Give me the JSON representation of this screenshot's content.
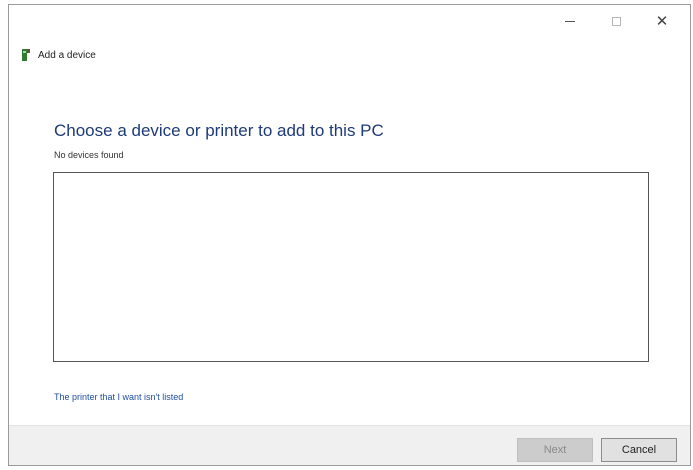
{
  "window": {
    "title": "Add a device",
    "controls": {
      "minimize_icon": "minimize-icon",
      "maximize_icon": "maximize-icon",
      "close_symbol": "✕"
    }
  },
  "main": {
    "heading": "Choose a device or printer to add to this PC",
    "status": "No devices found",
    "device_list": [],
    "printer_link": "The printer that I want isn't listed"
  },
  "footer": {
    "next_label": "Next",
    "cancel_label": "Cancel"
  },
  "colors": {
    "heading": "#1e3a78",
    "link": "#1f4e9c",
    "footer_bg": "#f0f0f0",
    "icon_green": "#2e7d32"
  }
}
